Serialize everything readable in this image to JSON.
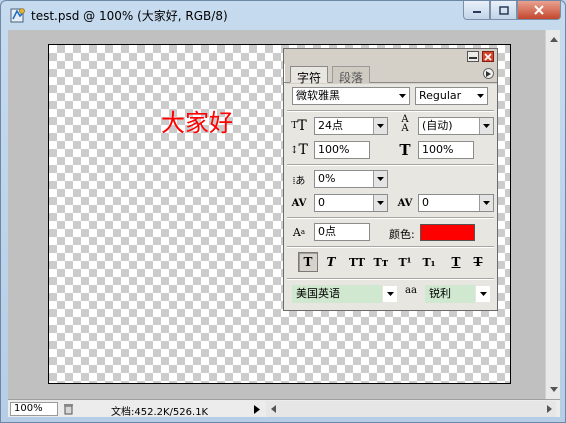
{
  "window": {
    "title": "test.psd @ 100% (大家好, RGB/8)"
  },
  "canvas": {
    "text": "大家好",
    "text_color": "#ff0000"
  },
  "status": {
    "zoom": "100%",
    "doc_info": "文档:452.2K/526.1K"
  },
  "palette": {
    "tabs": [
      {
        "label": "字符",
        "active": true
      },
      {
        "label": "段落",
        "active": false
      }
    ],
    "font_family": "微软雅黑",
    "font_style": "Regular",
    "font_size": "24点",
    "leading": "(自动)",
    "vertical_scale": "100%",
    "horizontal_scale": "100%",
    "tsume": "0%",
    "kerning": "0",
    "tracking": "0",
    "baseline_shift": "0点",
    "color_label": "颜色:",
    "color": "#ff0000",
    "style_buttons": [
      {
        "icon": "faux-bold-icon",
        "glyph": "T",
        "pressed": true
      },
      {
        "icon": "faux-italic-icon",
        "glyph": "T",
        "pressed": false
      },
      {
        "icon": "all-caps-icon",
        "glyph": "TT",
        "pressed": false
      },
      {
        "icon": "small-caps-icon",
        "glyph": "Tт",
        "pressed": false
      },
      {
        "icon": "superscript-icon",
        "glyph": "T¹",
        "pressed": false
      },
      {
        "icon": "subscript-icon",
        "glyph": "T₁",
        "pressed": false
      },
      {
        "icon": "underline-icon",
        "glyph": "T",
        "pressed": false
      },
      {
        "icon": "strikethrough-icon",
        "glyph": "T",
        "pressed": false
      }
    ],
    "language": "美国英语",
    "antialias_icon_text": "aa",
    "antialias": "锐利"
  }
}
